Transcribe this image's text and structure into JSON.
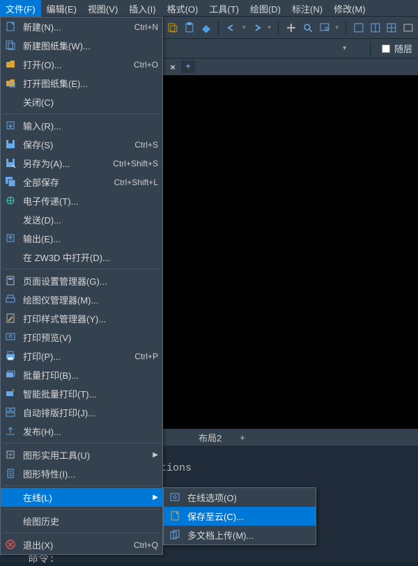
{
  "menubar": {
    "file": "文件(F)",
    "edit": "编辑(E)",
    "view": "视图(V)",
    "insert": "插入(I)",
    "format": "格式(O)",
    "tools": "工具(T)",
    "draw": "绘图(D)",
    "annotate": "标注(N)",
    "modify": "修改(M)"
  },
  "layer": {
    "label": "随层"
  },
  "bottom_tabs": {
    "layout2": "布局2",
    "plus": "+"
  },
  "cmd": {
    "line": "tions",
    "prompt": "命令:"
  },
  "file_menu": [
    {
      "icon": "new-icon",
      "label": "新建(N)...",
      "accel": "Ctrl+N"
    },
    {
      "icon": "new-sheet-icon",
      "label": "新建图纸集(W)..."
    },
    {
      "icon": "open-icon",
      "label": "打开(O)...",
      "accel": "Ctrl+O"
    },
    {
      "icon": "open-sheet-icon",
      "label": "打开图纸集(E)..."
    },
    {
      "icon": "",
      "label": "关闭(C)"
    },
    {
      "divider": true
    },
    {
      "icon": "import-icon",
      "label": "输入(R)..."
    },
    {
      "icon": "save-icon",
      "label": "保存(S)",
      "accel": "Ctrl+S"
    },
    {
      "icon": "saveas-icon",
      "label": "另存为(A)...",
      "accel": "Ctrl+Shift+S"
    },
    {
      "icon": "saveall-icon",
      "label": "全部保存",
      "accel": "Ctrl+Shift+L"
    },
    {
      "icon": "etransmit-icon",
      "label": "电子传递(T)..."
    },
    {
      "icon": "",
      "label": "发送(D)..."
    },
    {
      "icon": "export-icon",
      "label": "输出(E)..."
    },
    {
      "icon": "",
      "label": "在 ZW3D 中打开(D)..."
    },
    {
      "divider": true
    },
    {
      "icon": "pagesetup-icon",
      "label": "页面设置管理器(G)..."
    },
    {
      "icon": "plotter-icon",
      "label": "绘图仪管理器(M)..."
    },
    {
      "icon": "plotstyle-icon",
      "label": "打印样式管理器(Y)..."
    },
    {
      "icon": "preview-icon",
      "label": "打印预览(V)"
    },
    {
      "icon": "print-icon",
      "label": "打印(P)...",
      "accel": "Ctrl+P"
    },
    {
      "icon": "batch-icon",
      "label": "批量打印(B)..."
    },
    {
      "icon": "smart-batch-icon",
      "label": "智能批量打印(T)..."
    },
    {
      "icon": "auto-layout-icon",
      "label": "自动排版打印(J)..."
    },
    {
      "icon": "publish-icon",
      "label": "发布(H)..."
    },
    {
      "divider": true
    },
    {
      "icon": "utilities-icon",
      "label": "图形实用工具(U)",
      "arrow": true
    },
    {
      "icon": "properties-icon",
      "label": "图形特性(I)..."
    },
    {
      "divider": true
    },
    {
      "icon": "",
      "label": "在线(L)",
      "arrow": true,
      "hover": true
    },
    {
      "divider": true
    },
    {
      "icon": "",
      "label": "绘图历史"
    },
    {
      "divider": true
    },
    {
      "icon": "exit-icon",
      "label": "退出(X)",
      "accel": "Ctrl+Q"
    }
  ],
  "online_submenu": [
    {
      "icon": "options-icon",
      "label": "在线选项(O)"
    },
    {
      "icon": "cloud-save-icon",
      "label": "保存至云(C)...",
      "hover": true
    },
    {
      "icon": "multi-upload-icon",
      "label": "多文档上传(M)..."
    }
  ]
}
